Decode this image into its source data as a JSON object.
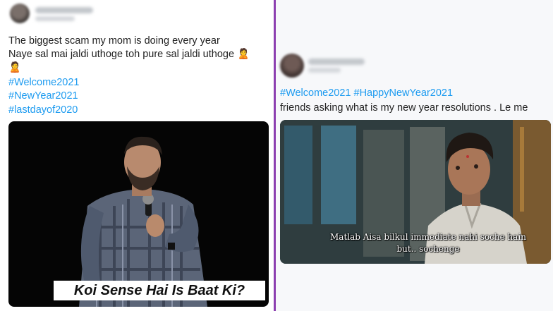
{
  "left_tweet": {
    "lines": [
      "The biggest scam my mom is doing every year",
      "Naye sal mai jaldi uthoge toh pure sal jaldi uthoge",
      "🙎",
      "#Welcome2021",
      "#NewYear2021",
      "#lastdayof2020"
    ],
    "emoji": "🙎",
    "media_caption": "Koi Sense Hai Is Baat Ki?"
  },
  "right_tweet": {
    "hashtags_line": "#Welcome2021 #HappyNewYear2021",
    "text_line": "friends asking what is my new year resolutions . Le me",
    "media_caption": "Matlab Aisa bilkul immediate nahi soche hain but.. sochenge"
  },
  "colors": {
    "divider": "#8c3fb0",
    "hashtag": "#1d9bf0"
  }
}
